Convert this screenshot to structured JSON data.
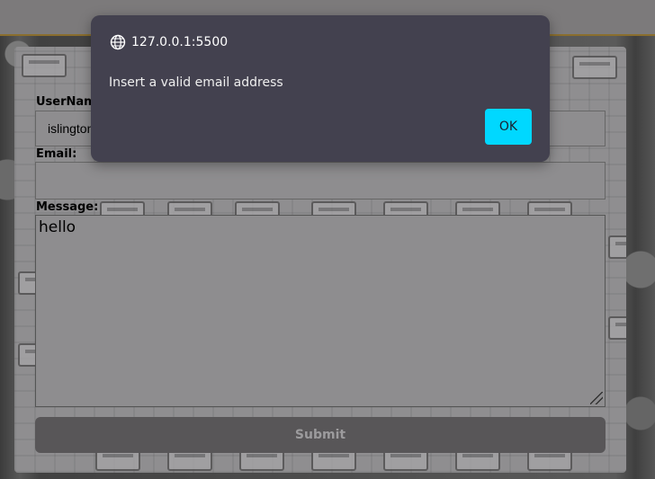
{
  "form": {
    "username_label": "UserName:",
    "username_value": "islington",
    "email_label": "Email:",
    "email_value": "",
    "message_label": "Message:",
    "message_value": "hello",
    "submit_label": "Submit"
  },
  "alert": {
    "origin": "127.0.0.1:5500",
    "message": "Insert a valid email address",
    "ok_label": "OK",
    "ok_color": "#00d8ff"
  },
  "icons": {
    "origin_icon": "globe-icon"
  }
}
